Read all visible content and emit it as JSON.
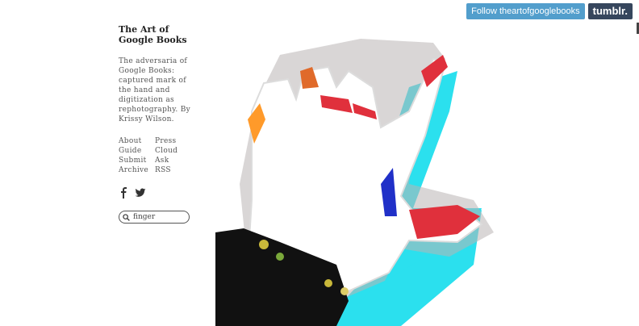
{
  "header": {
    "follow_label": "Follow theartofgooglebooks",
    "tumblr_label": "tumblr."
  },
  "sidebar": {
    "title": "The Art of Google Books",
    "description": "The adversaria of Google Books: captured mark of the hand and digitization as rephotography. By Krissy Wilson.",
    "nav": {
      "about": "About",
      "press": "Press",
      "guide": "Guide",
      "cloud": "Cloud",
      "submit": "Submit",
      "ask": "Ask",
      "archive": "Archive",
      "rss": "RSS"
    },
    "social_icons": [
      "facebook-icon",
      "twitter-icon"
    ],
    "search": {
      "value": "finger"
    }
  },
  "colors": {
    "follow_bg": "#529ecc",
    "tumblr_bg": "#36465d",
    "cyan": "#2be0ee",
    "red": "#e0303c"
  }
}
